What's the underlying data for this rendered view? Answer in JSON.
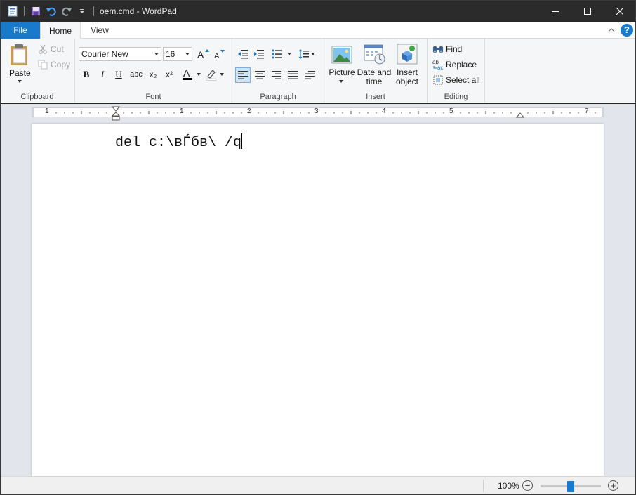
{
  "window": {
    "title": "oem.cmd - WordPad",
    "minimize_glyph": "—",
    "maximize_glyph": "☐",
    "close_glyph": "✕"
  },
  "tabs": [
    {
      "label": "File",
      "state": "menu"
    },
    {
      "label": "Home",
      "state": "selected"
    },
    {
      "label": "View",
      "state": "normal"
    }
  ],
  "help_label": "?",
  "clipboard": {
    "group_label": "Clipboard",
    "paste_label": "Paste",
    "cut_label": "Cut",
    "copy_label": "Copy"
  },
  "font": {
    "group_label": "Font",
    "family": "Courier New",
    "size": "16",
    "bold_label": "B",
    "italic_label": "I",
    "underline_label": "U",
    "strike_label": "abc",
    "subscript_label": "x₂",
    "superscript_label": "x²",
    "text_color": "#000000",
    "highlight_color": "#ffffff"
  },
  "paragraph": {
    "group_label": "Paragraph",
    "active_alignment": "left"
  },
  "insert": {
    "group_label": "Insert",
    "picture_label": "Picture",
    "datetime_line1": "Date and",
    "datetime_line2": "time",
    "object_line1": "Insert",
    "object_line2": "object"
  },
  "editing": {
    "group_label": "Editing",
    "find_label": "Find",
    "replace_label": "Replace",
    "select_all_label": "Select all"
  },
  "ruler": {
    "numbers": [
      "1",
      "1",
      "2",
      "3",
      "4",
      "5",
      "7"
    ]
  },
  "document": {
    "text": "del c:\\вЃбв\\ /q"
  },
  "status": {
    "zoom_level": "100%",
    "zoom_out_glyph": "−",
    "zoom_in_glyph": "+",
    "zoom_fraction": 0.5
  },
  "colors": {
    "accent": "#1979ca",
    "titlebar": "#2b2b2b",
    "ribbon": "#f5f6f7",
    "workspace": "#e2e6ec"
  }
}
